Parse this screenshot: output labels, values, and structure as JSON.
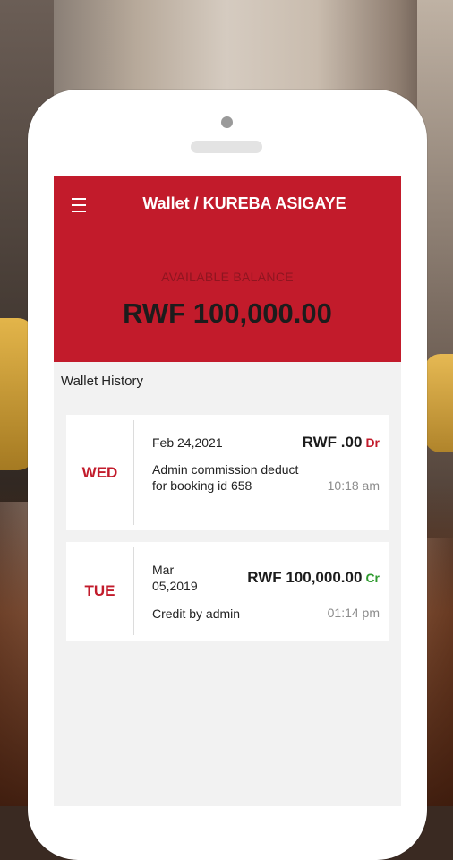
{
  "header": {
    "title": "Wallet / KUREBA ASIGAYE"
  },
  "balance": {
    "label": "AVAILABLE BALANCE",
    "value": "RWF 100,000.00"
  },
  "history": {
    "title": "Wallet History",
    "items": [
      {
        "day": "WED",
        "date": "Feb 24,2021",
        "amount": "RWF .00",
        "type": "Dr",
        "description": "Admin commission deduct for booking id 658",
        "time": "10:18 am"
      },
      {
        "day": "TUE",
        "date_line1": "Mar",
        "date_line2": "05,2019",
        "amount": "RWF 100,000.00",
        "type": "Cr",
        "description": "Credit by admin",
        "time": "01:14 pm"
      }
    ]
  },
  "colors": {
    "brand": "#c21b2b",
    "credit": "#2e9a2e",
    "muted": "#8c8c8c"
  },
  "icons": {
    "menu": "hamburger-menu-icon"
  }
}
